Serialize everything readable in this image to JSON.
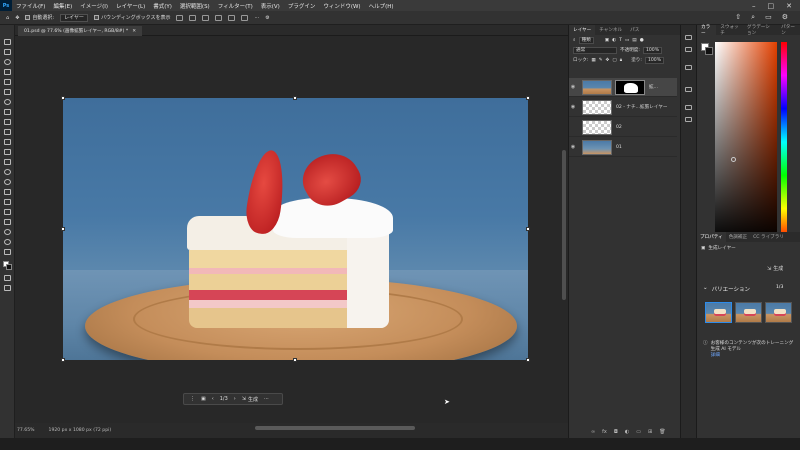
{
  "menubar": {
    "logo": "Ps",
    "items": [
      "ファイル(F)",
      "編集(E)",
      "イメージ(I)",
      "レイヤー(L)",
      "書式(Y)",
      "選択範囲(S)",
      "フィルター(T)",
      "表示(V)",
      "プラグイン",
      "ウィンドウ(W)",
      "ヘルプ(H)"
    ]
  },
  "options": {
    "auto_select_label": "自動選択:",
    "auto_select_value": "レイヤー",
    "bounding_box_label": "バウンディングボックスを表示"
  },
  "document": {
    "tab_title": "01.psd @ 77.6% (画像拡張レイヤー, RGB/8#) *"
  },
  "context_bar": {
    "counter": "1/3",
    "generate_label": "生成"
  },
  "status": {
    "zoom": "77.65%",
    "dimensions": "1920 px x 1080 px (72 ppi)"
  },
  "layers_panel": {
    "tabs": [
      "レイヤー",
      "チャンネル",
      "パス"
    ],
    "filter_label": "種類",
    "blend_mode": "通常",
    "opacity_label": "不透明度:",
    "opacity_value": "100%",
    "lock_label": "ロック:",
    "fill_label": "塗り:",
    "fill_value": "100%",
    "layers": [
      {
        "name": "拡...",
        "selected": true,
        "has_mask": true
      },
      {
        "name": "02 - ナチ...拡張レイヤー",
        "selected": false,
        "has_mask": false
      },
      {
        "name": "02",
        "selected": false,
        "has_mask": false
      },
      {
        "name": "01",
        "selected": false,
        "has_mask": false
      }
    ]
  },
  "color_panel": {
    "tabs": [
      "カラー",
      "スウォッチ",
      "グラデーション",
      "パターン"
    ],
    "fg_color": "#ffffff",
    "bg_color": "#111111"
  },
  "properties_panel": {
    "tabs": [
      "プロパティ",
      "色調補正",
      "CC ライブラリ"
    ],
    "layer_type": "生成レイヤー",
    "generate_label": "生成",
    "variations_label": "バリエーション",
    "variations_count": "1/3",
    "notice_text": "お客様のコンテンツが次のトレーニング生成 AI モデル",
    "notice_link": "詳細"
  },
  "colors": {
    "accent": "#2d8ceb",
    "panel_bg": "#323232",
    "canvas_bg": "#282828"
  }
}
